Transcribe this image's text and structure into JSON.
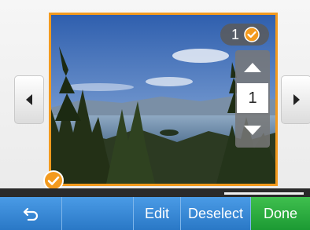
{
  "navigation": {
    "prev_icon": "chevron-left-icon",
    "next_icon": "chevron-right-icon"
  },
  "photo": {
    "selected": true,
    "frame_color": "#f39a1e"
  },
  "selection": {
    "count": "1"
  },
  "copies": {
    "value": "1"
  },
  "toolbar": {
    "back_icon": "back-arrow-icon",
    "edit_label": "Edit",
    "deselect_label": "Deselect",
    "done_label": "Done"
  },
  "colors": {
    "accent": "#f39a1e",
    "toolbar": "#2a78c6",
    "done": "#1c9a33"
  }
}
